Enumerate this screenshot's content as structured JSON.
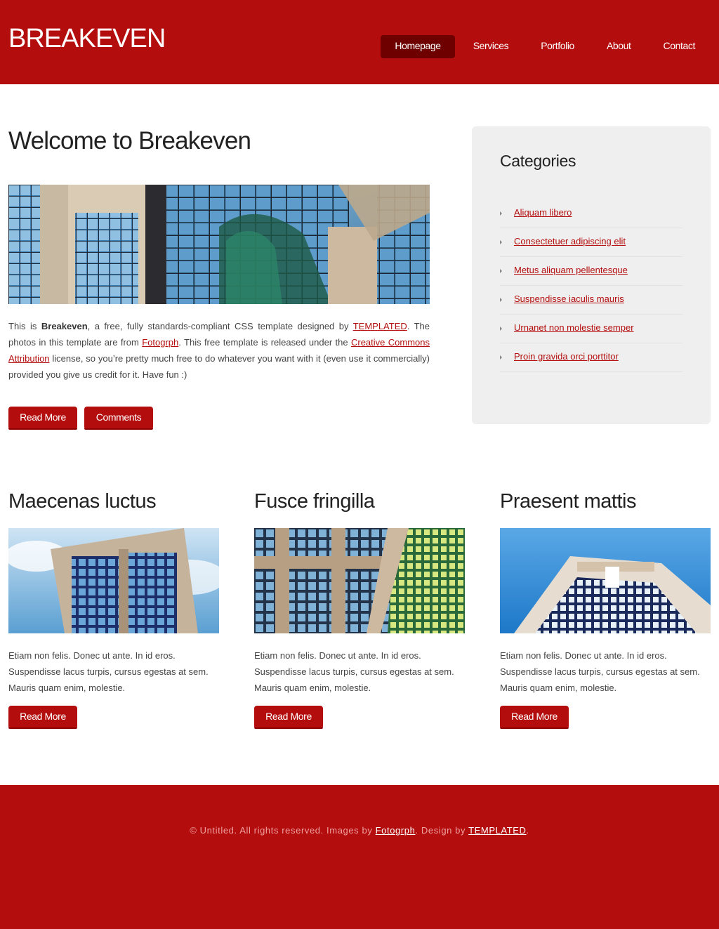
{
  "header": {
    "logo": "BREAKEVEN",
    "nav": [
      "Homepage",
      "Services",
      "Portfolio",
      "About",
      "Contact"
    ],
    "active_nav": "Homepage"
  },
  "main": {
    "title": "Welcome to Breakeven",
    "intro": {
      "t1": "This is ",
      "brand": "Breakeven",
      "t2": ", a free, fully standards-compliant CSS template designed by ",
      "link1": "TEMPLATED",
      "t3": ". The photos in this template are from ",
      "link2": "Fotogrph",
      "t4": ". This free template is released under the ",
      "link3": "Creative Commons Attribution",
      "t5": " license, so you’re pretty much free to do whatever you want with it (even use it commercially) provided you give us credit for it. Have fun :)"
    },
    "read_more": "Read More",
    "comments": "Comments"
  },
  "sidebar": {
    "title": "Categories",
    "items": [
      "Aliquam libero",
      "Consectetuer adipiscing elit",
      "Metus aliquam pellentesque",
      "Suspendisse iaculis mauris",
      "Urnanet non molestie semper",
      "Proin gravida orci porttitor"
    ]
  },
  "columns": [
    {
      "title": "Maecenas luctus",
      "text": "Etiam non felis. Donec ut ante. In id eros. Suspendisse lacus turpis, cursus egestas at sem. Mauris quam enim, molestie.",
      "button": "Read More"
    },
    {
      "title": "Fusce fringilla",
      "text": "Etiam non felis. Donec ut ante. In id eros. Suspendisse lacus turpis, cursus egestas at sem. Mauris quam enim, molestie.",
      "button": "Read More"
    },
    {
      "title": "Praesent mattis",
      "text": "Etiam non felis. Donec ut ante. In id eros. Suspendisse lacus turpis, cursus egestas at sem. Mauris quam enim, molestie.",
      "button": "Read More"
    }
  ],
  "footer": {
    "t1": "© Untitled. All rights reserved. Images by ",
    "link1": "Fotogrph",
    "t2": ". Design by ",
    "link2": "TEMPLATED",
    "t3": "."
  },
  "colors": {
    "brand_red": "#b40d0d",
    "nav_active": "#6e0000",
    "sidebar_bg": "#efefef"
  }
}
